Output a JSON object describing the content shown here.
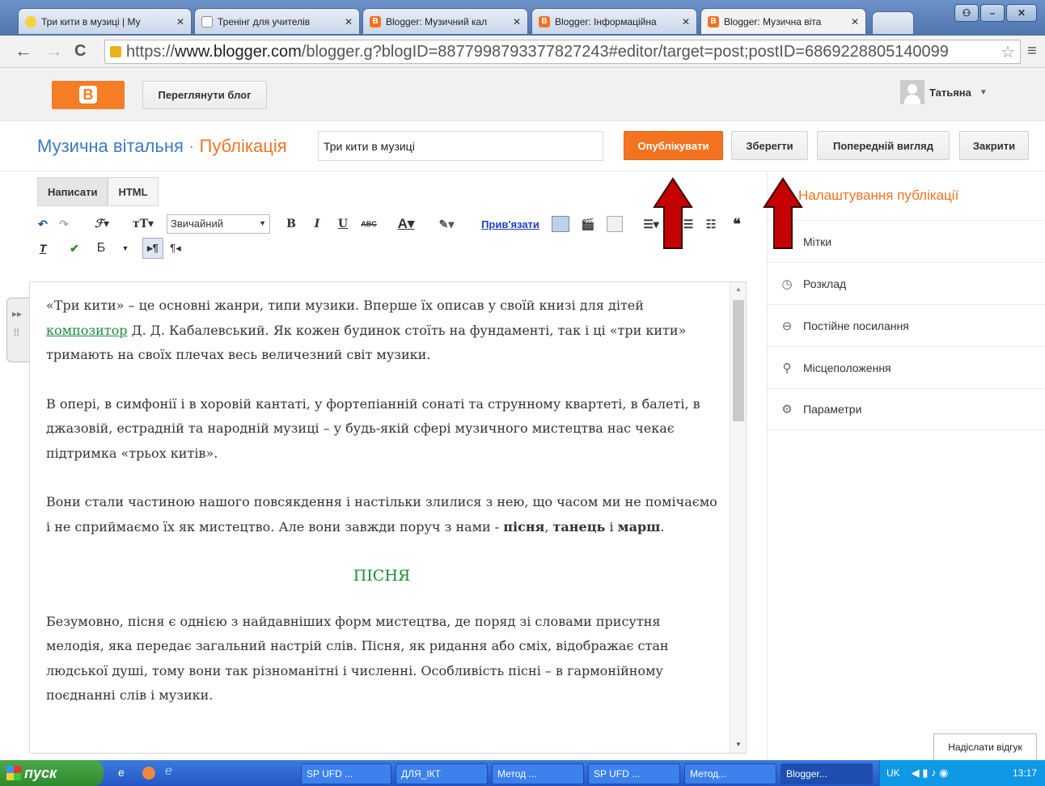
{
  "browser": {
    "tabs": [
      {
        "label": "Три кити в музиці | Му",
        "icon": "music-note-icon"
      },
      {
        "label": "Тренінг для учителів",
        "icon": "page-icon"
      },
      {
        "label": "Blogger: Музичний кал",
        "icon": "blogger-icon"
      },
      {
        "label": "Blogger: Інформаційна",
        "icon": "blogger-icon"
      },
      {
        "label": "Blogger: Музична віта",
        "icon": "blogger-icon"
      }
    ],
    "url_scheme": "https://",
    "url_host": "www.blogger.com",
    "url_rest": "/blogger.g?blogID=8877998793377827243#editor/target=post;postID=6869228805140099"
  },
  "header": {
    "view_blog": "Переглянути блог",
    "user_name": "Татьяна"
  },
  "titlebar": {
    "blog_name": "Музична вітальня",
    "separator": "·",
    "section": "Публікація",
    "post_title": "Три кити в музиці",
    "publish": "Опублікувати",
    "save": "Зберегти",
    "preview": "Попередній вигляд",
    "close": "Закрити"
  },
  "editor": {
    "mode_compose": "Написати",
    "mode_html": "HTML",
    "font_size": "Звичайний",
    "link": "Прив'язати",
    "para1": "«Три кити» – це основні жанри, типи музики. Вперше їх описав у своїй книзі для дітей ",
    "para1_link": "композитор",
    "para1_end": " Д. Д. Кабалевський. Як кожен будинок стоїть на фундаменті, так і ці «три кити» тримають на своїх плечах весь величезний світ музики.",
    "para2": "В опері, в симфонії і в хоровій кантаті, у фортепіанній сонаті та струнному квартеті, в балеті, в джазовій, естрадній та народній музиці – у будь-якій сфері музичного мистецтва нас чекає підтримка «трьох китів».",
    "para3": "Вони стали частиною нашого повсякдення і настільки злилися з нею, що часом ми не помічаємо і не сприймаємо їх як мистецтво.  Але вони завжди поруч з нами - ",
    "para3_b1": "пісня",
    "para3_c": ", ",
    "para3_b2": "танець",
    "para3_and": " і ",
    "para3_b3": "марш",
    "para3_dot": ".",
    "heading": "ПІСНЯ",
    "para4": "Безумовно, пісня є однією з найдавніших форм мистецтва, де поряд зі словами присутня мелодія, яка передає загальний настрій слів. Пісня, як ридання або сміх, відображає стан людської душі, тому вони так різноманітні і численні. Особливість пісні – в гармонійному поєднанні слів і музики."
  },
  "sidebar": {
    "title": "Налаштування публікації",
    "items": [
      {
        "label": "Мітки",
        "icon": "tag-icon"
      },
      {
        "label": "Розклад",
        "icon": "clock-icon"
      },
      {
        "label": "Постійне посилання",
        "icon": "link-icon"
      },
      {
        "label": "Місцеположення",
        "icon": "location-pin-icon"
      },
      {
        "label": "Параметри",
        "icon": "gear-icon"
      }
    ],
    "feedback": "Надіслати відгук"
  },
  "taskbar": {
    "start": "пуск",
    "items": [
      "SP UFD ...",
      "ДЛЯ_ІКТ",
      "Метод ...",
      "SP UFD ...",
      "Метод...",
      "Blogger..."
    ],
    "lang": "UK",
    "time": "13:17"
  },
  "colors": {
    "accent": "#f37321",
    "blog_title": "#3b7bbf",
    "arrow": "#c40000",
    "heading_green": "#1a8c38"
  }
}
